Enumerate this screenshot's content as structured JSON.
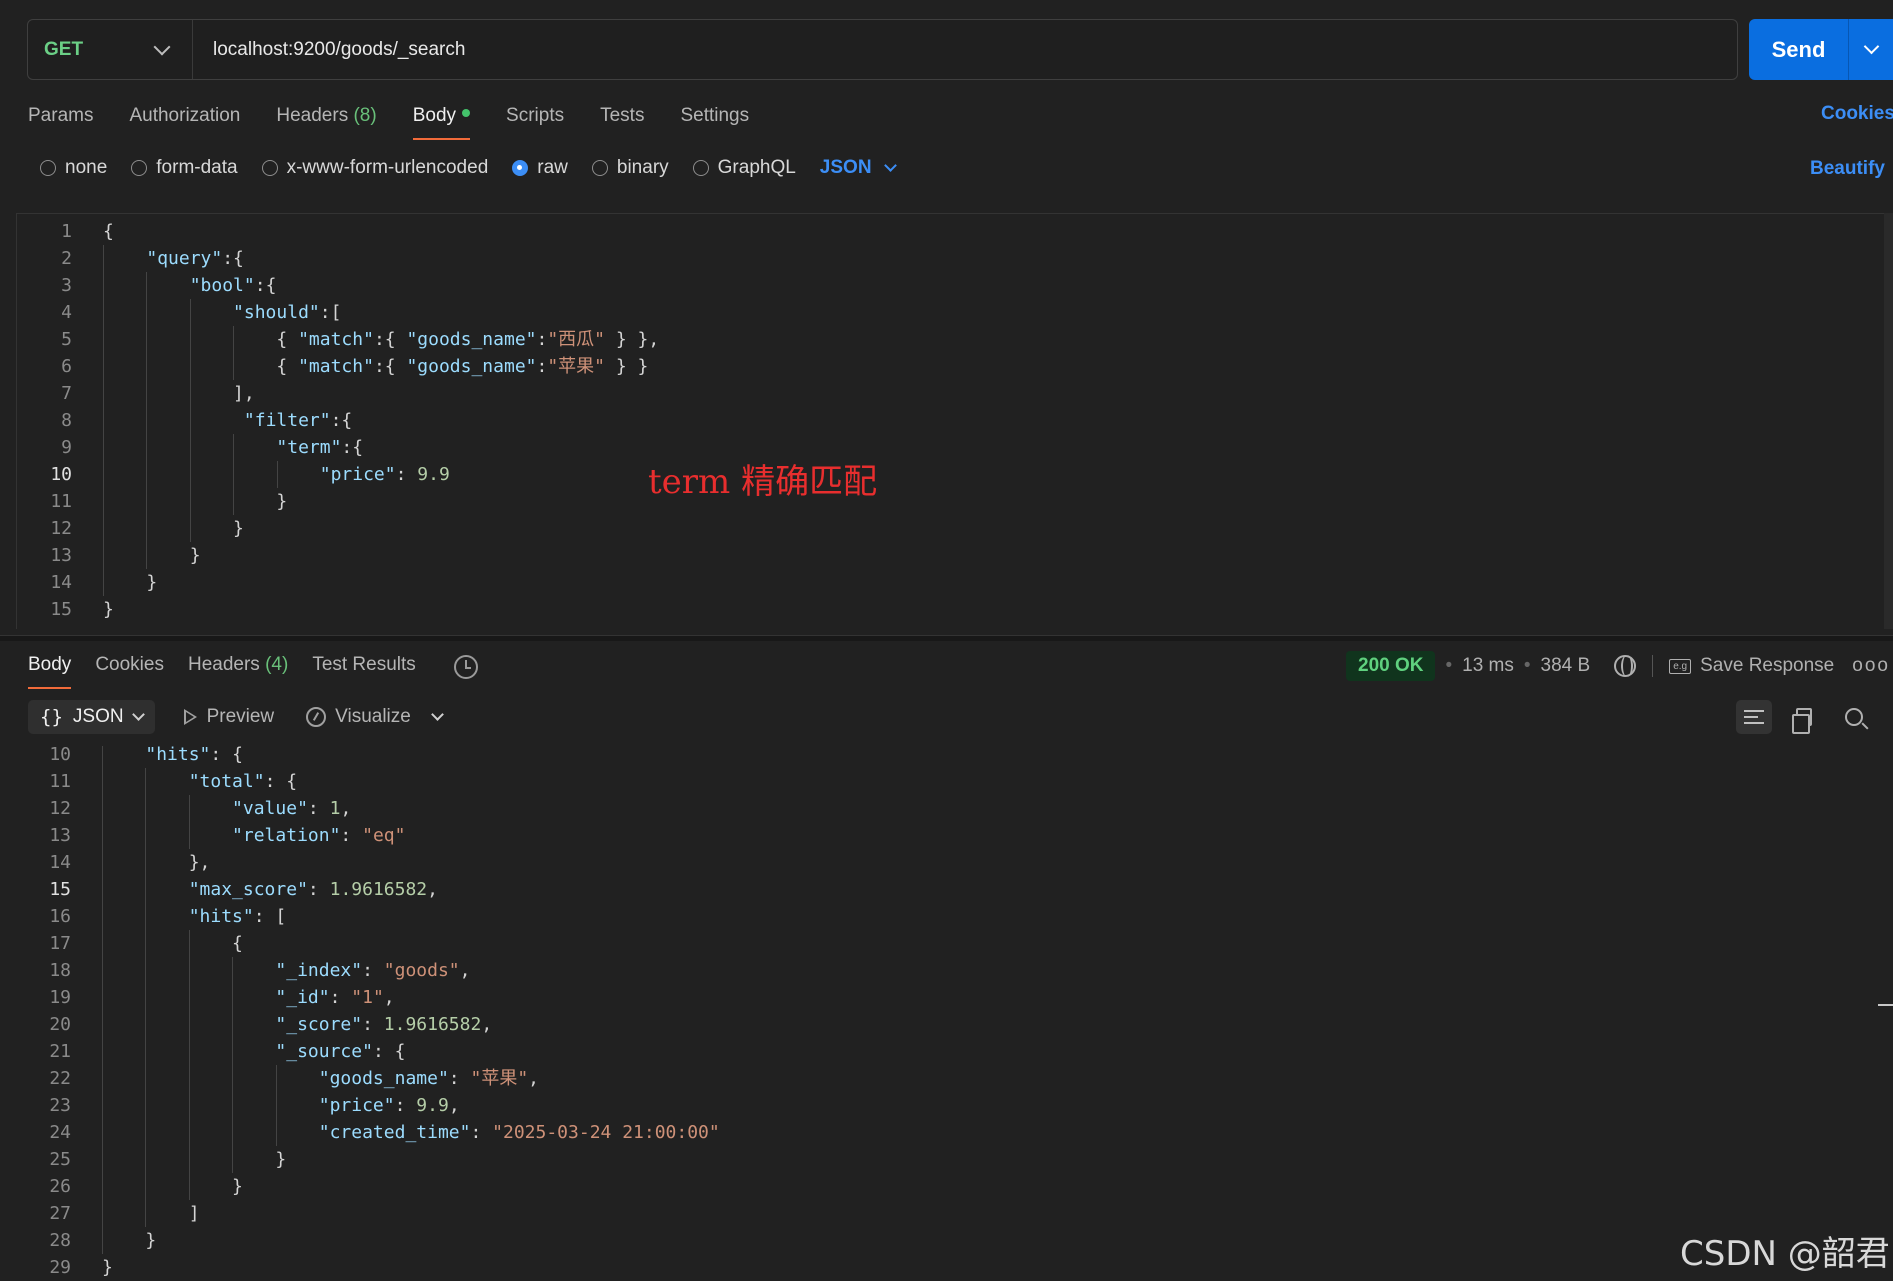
{
  "request": {
    "method": "GET",
    "url": "localhost:9200/goods/_search",
    "send_label": "Send",
    "tabs": [
      {
        "label": "Params",
        "count": ""
      },
      {
        "label": "Authorization",
        "count": ""
      },
      {
        "label": "Headers",
        "count": "(8)"
      },
      {
        "label": "Body",
        "count": ""
      },
      {
        "label": "Scripts",
        "count": ""
      },
      {
        "label": "Tests",
        "count": ""
      },
      {
        "label": "Settings",
        "count": ""
      }
    ],
    "cookies_label": "Cookies",
    "body_types": [
      "none",
      "form-data",
      "x-www-form-urlencoded",
      "raw",
      "binary",
      "GraphQL"
    ],
    "selected_body_type": "raw",
    "language": "JSON",
    "beautify_label": "Beautify",
    "code_lines": [
      "{",
      "    \"query\":{",
      "        \"bool\":{",
      "            \"should\":[",
      "                { \"match\":{ \"goods_name\":\"西瓜\" } },",
      "                { \"match\":{ \"goods_name\":\"苹果\" } }",
      "            ],",
      "             \"filter\":{",
      "                \"term\":{",
      "                    \"price\": 9.9",
      "                }",
      "            }",
      "        }",
      "    }",
      "}",
      ""
    ],
    "current_line": 10,
    "annotation": "term 精确匹配"
  },
  "response": {
    "tabs": [
      {
        "label": "Body",
        "count": ""
      },
      {
        "label": "Cookies",
        "count": ""
      },
      {
        "label": "Headers",
        "count": "(4)"
      },
      {
        "label": "Test Results",
        "count": ""
      }
    ],
    "status": "200 OK",
    "time": "13 ms",
    "size": "384 B",
    "save_label": "Save Response",
    "save_icon_text": "e.g",
    "more_label": "ooo",
    "format_braces": "{}",
    "format": "JSON",
    "preview_label": "Preview",
    "visualize_label": "Visualize",
    "first_line": 10,
    "current_line": 15,
    "code_lines": [
      "    \"hits\": {",
      "        \"total\": {",
      "            \"value\": 1,",
      "            \"relation\": \"eq\"",
      "        },",
      "        \"max_score\": 1.9616582,",
      "        \"hits\": [",
      "            {",
      "                \"_index\": \"goods\",",
      "                \"_id\": \"1\",",
      "                \"_score\": 1.9616582,",
      "                \"_source\": {",
      "                    \"goods_name\": \"苹果\",",
      "                    \"price\": 9.9,",
      "                    \"created_time\": \"2025-03-24 21:00:00\"",
      "                }",
      "            }",
      "        ]",
      "    }",
      "}"
    ]
  },
  "watermark": "CSDN @韶君",
  "colors": {
    "accent_blue": "#0a6ee0",
    "tab_underline": "#f26b3a",
    "status_green": "#5fd07e",
    "annotation_red": "#e82e2e"
  }
}
